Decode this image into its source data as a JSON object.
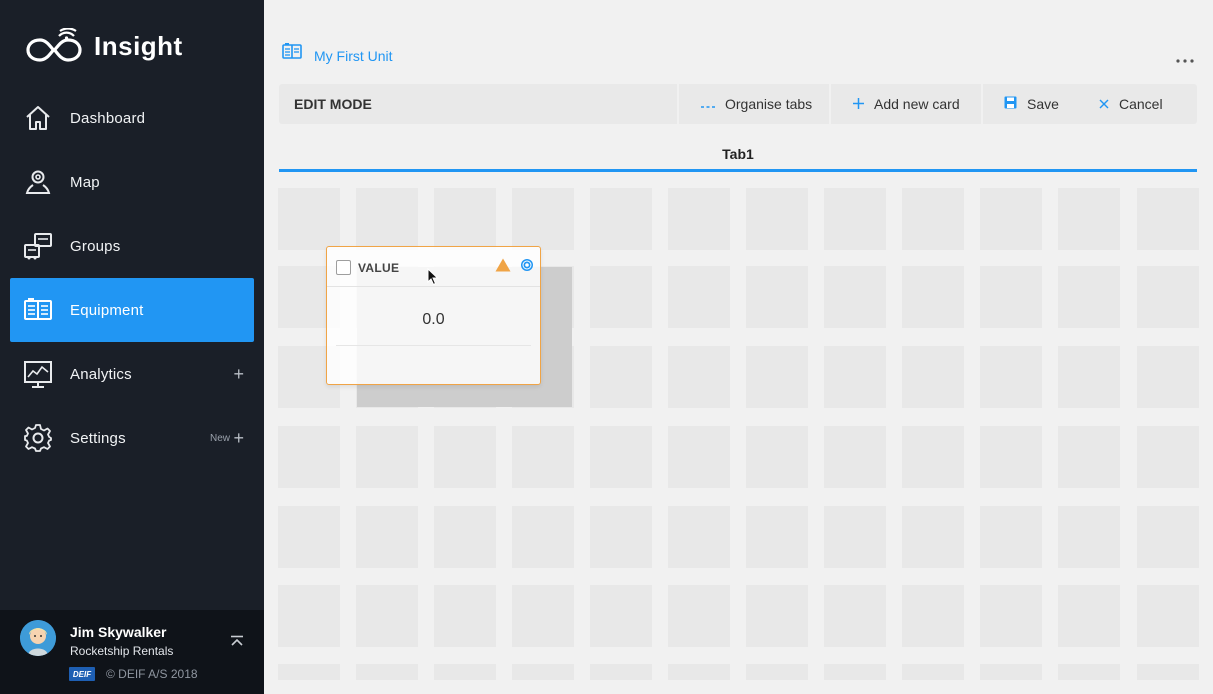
{
  "app": {
    "name": "Insight"
  },
  "sidebar": {
    "items": [
      {
        "label": "Dashboard",
        "icon": "home-icon"
      },
      {
        "label": "Map",
        "icon": "map-pin-icon"
      },
      {
        "label": "Groups",
        "icon": "groups-icon"
      },
      {
        "label": "Equipment",
        "icon": "equipment-icon",
        "active": true
      },
      {
        "label": "Analytics",
        "icon": "analytics-icon",
        "action": "+"
      },
      {
        "label": "Settings",
        "icon": "settings-gear-icon",
        "badge": "New",
        "action": "+"
      }
    ]
  },
  "user": {
    "name": "Jim Skywalker",
    "organization": "Rocketship Rentals",
    "brand": "DEIF",
    "copyright": "© DEIF A/S 2018"
  },
  "breadcrumb": {
    "unit": "My First Unit"
  },
  "toolbar": {
    "mode": "EDIT MODE",
    "organise_label": "Organise tabs",
    "add_card_label": "Add new card",
    "save_label": "Save",
    "cancel_label": "Cancel"
  },
  "tabs": [
    {
      "label": "Tab1",
      "active": true
    }
  ],
  "card": {
    "title": "VALUE",
    "value": "0.0"
  },
  "colors": {
    "accent": "#2196f3",
    "sidebar_bg": "#1a1f28",
    "warning": "#f0a446"
  }
}
